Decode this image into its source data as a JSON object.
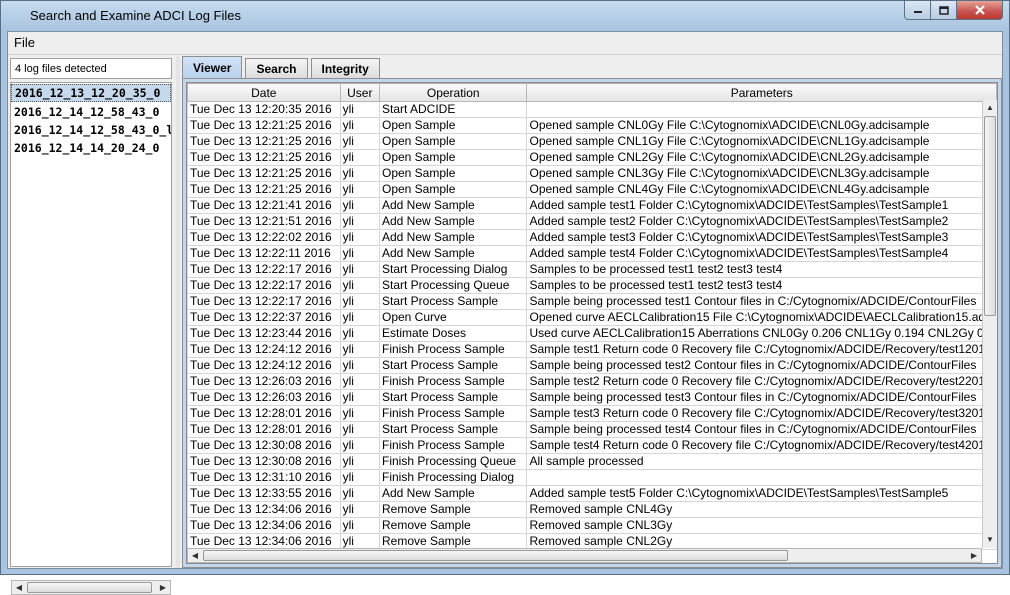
{
  "window": {
    "title": "Search and Examine ADCI Log Files",
    "minimize_icon": "minimize-icon",
    "maximize_icon": "maximize-icon",
    "close_icon": "close-icon"
  },
  "menu": {
    "file": "File"
  },
  "left": {
    "detected_label": "4 log files detected",
    "files": [
      "2016_12_13_12_20_35_0",
      "2016_12_14_12_58_43_0",
      "2016_12_14_12_58_43_0_l",
      "2016_12_14_14_20_24_0"
    ],
    "selected_index": 0
  },
  "tabs": [
    "Viewer",
    "Search",
    "Integrity"
  ],
  "active_tab": "Viewer",
  "table": {
    "columns": [
      "Date",
      "User",
      "Operation",
      "Parameters"
    ],
    "rows": [
      [
        "Tue Dec 13 12:20:35 2016",
        "yli",
        "Start ADCIDE",
        ""
      ],
      [
        "Tue Dec 13 12:21:25 2016",
        "yli",
        "Open Sample",
        "Opened sample CNL0Gy File C:\\Cytognomix\\ADCIDE\\CNL0Gy.adcisample"
      ],
      [
        "Tue Dec 13 12:21:25 2016",
        "yli",
        "Open Sample",
        "Opened sample CNL1Gy File C:\\Cytognomix\\ADCIDE\\CNL1Gy.adcisample"
      ],
      [
        "Tue Dec 13 12:21:25 2016",
        "yli",
        "Open Sample",
        "Opened sample CNL2Gy File C:\\Cytognomix\\ADCIDE\\CNL2Gy.adcisample"
      ],
      [
        "Tue Dec 13 12:21:25 2016",
        "yli",
        "Open Sample",
        "Opened sample CNL3Gy File C:\\Cytognomix\\ADCIDE\\CNL3Gy.adcisample"
      ],
      [
        "Tue Dec 13 12:21:25 2016",
        "yli",
        "Open Sample",
        "Opened sample CNL4Gy File C:\\Cytognomix\\ADCIDE\\CNL4Gy.adcisample"
      ],
      [
        "Tue Dec 13 12:21:41 2016",
        "yli",
        "Add New Sample",
        "Added sample test1 Folder C:\\Cytognomix\\ADCIDE\\TestSamples\\TestSample1"
      ],
      [
        "Tue Dec 13 12:21:51 2016",
        "yli",
        "Add New Sample",
        "Added sample test2 Folder C:\\Cytognomix\\ADCIDE\\TestSamples\\TestSample2"
      ],
      [
        "Tue Dec 13 12:22:02 2016",
        "yli",
        "Add New Sample",
        "Added sample test3 Folder C:\\Cytognomix\\ADCIDE\\TestSamples\\TestSample3"
      ],
      [
        "Tue Dec 13 12:22:11 2016",
        "yli",
        "Add New Sample",
        "Added sample test4 Folder C:\\Cytognomix\\ADCIDE\\TestSamples\\TestSample4"
      ],
      [
        "Tue Dec 13 12:22:17 2016",
        "yli",
        "Start Processing Dialog",
        "Samples to be processed test1 test2 test3 test4"
      ],
      [
        "Tue Dec 13 12:22:17 2016",
        "yli",
        "Start Processing Queue",
        "Samples to be processed test1 test2 test3 test4"
      ],
      [
        "Tue Dec 13 12:22:17 2016",
        "yli",
        "Start Process Sample",
        "Sample being processed test1 Contour files in C:/Cytognomix/ADCIDE/ContourFiles"
      ],
      [
        "Tue Dec 13 12:22:37 2016",
        "yli",
        "Open Curve",
        "Opened curve AECLCalibration15 File C:\\Cytognomix\\ADCIDE\\AECLCalibration15.ad"
      ],
      [
        "Tue Dec 13 12:23:44 2016",
        "yli",
        "Estimate Doses",
        "Used curve AECLCalibration15 Aberrations CNL0Gy 0.206 CNL1Gy 0.194 CNL2Gy 0"
      ],
      [
        "Tue Dec 13 12:24:12 2016",
        "yli",
        "Finish Process Sample",
        "Sample test1 Return code 0 Recovery file C:/Cytognomix/ADCIDE/Recovery/test1201"
      ],
      [
        "Tue Dec 13 12:24:12 2016",
        "yli",
        "Start Process Sample",
        "Sample being processed test2 Contour files in C:/Cytognomix/ADCIDE/ContourFiles"
      ],
      [
        "Tue Dec 13 12:26:03 2016",
        "yli",
        "Finish Process Sample",
        "Sample test2 Return code 0 Recovery file C:/Cytognomix/ADCIDE/Recovery/test2201"
      ],
      [
        "Tue Dec 13 12:26:03 2016",
        "yli",
        "Start Process Sample",
        "Sample being processed test3 Contour files in C:/Cytognomix/ADCIDE/ContourFiles"
      ],
      [
        "Tue Dec 13 12:28:01 2016",
        "yli",
        "Finish Process Sample",
        "Sample test3 Return code 0 Recovery file C:/Cytognomix/ADCIDE/Recovery/test3201"
      ],
      [
        "Tue Dec 13 12:28:01 2016",
        "yli",
        "Start Process Sample",
        "Sample being processed test4 Contour files in C:/Cytognomix/ADCIDE/ContourFiles"
      ],
      [
        "Tue Dec 13 12:30:08 2016",
        "yli",
        "Finish Process Sample",
        "Sample test4 Return code 0 Recovery file C:/Cytognomix/ADCIDE/Recovery/test4201"
      ],
      [
        "Tue Dec 13 12:30:08 2016",
        "yli",
        "Finish Processing Queue",
        "All sample processed"
      ],
      [
        "Tue Dec 13 12:31:10 2016",
        "yli",
        "Finish Processing Dialog",
        ""
      ],
      [
        "Tue Dec 13 12:33:55 2016",
        "yli",
        "Add New Sample",
        "Added sample test5 Folder C:\\Cytognomix\\ADCIDE\\TestSamples\\TestSample5"
      ],
      [
        "Tue Dec 13 12:34:06 2016",
        "yli",
        "Remove Sample",
        "Removed sample CNL4Gy"
      ],
      [
        "Tue Dec 13 12:34:06 2016",
        "yli",
        "Remove Sample",
        "Removed sample CNL3Gy"
      ],
      [
        "Tue Dec 13 12:34:06 2016",
        "yli",
        "Remove Sample",
        "Removed sample CNL2Gy"
      ]
    ]
  },
  "colors": {
    "titlebar": "#a9c4df",
    "selected_row": "#c6d8ec",
    "active_tab": "#b9d1ec"
  }
}
